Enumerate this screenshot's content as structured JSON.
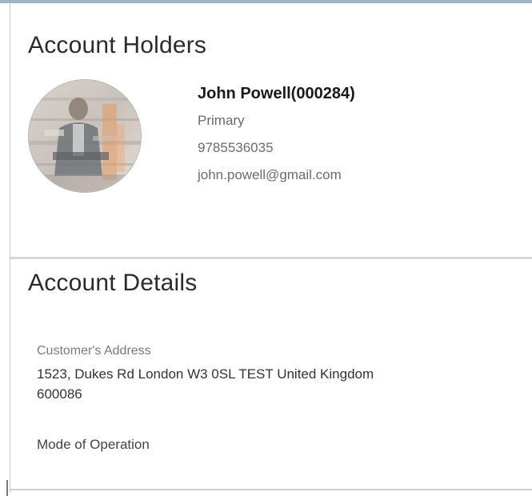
{
  "account_holders": {
    "title": "Account Holders",
    "holder": {
      "name": "John Powell(000284)",
      "role": "Primary",
      "phone": "9785536035",
      "email": "john.powell@gmail.com",
      "avatar_icon": "user-photo"
    }
  },
  "account_details": {
    "title": "Account Details",
    "address_label": "Customer's Address",
    "address_line1": "1523, Dukes Rd London W3 0SL TEST United Kingdom",
    "address_line2": "600086",
    "mode_label": "Mode of Operation"
  }
}
